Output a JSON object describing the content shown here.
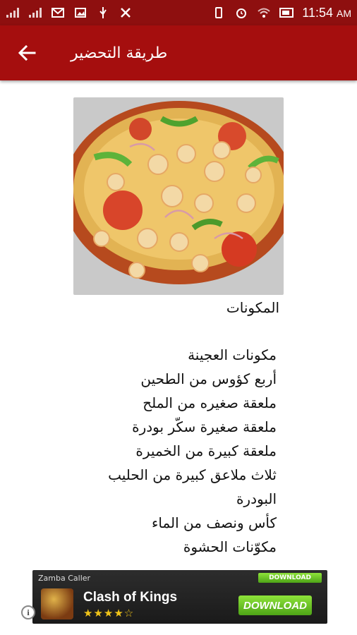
{
  "status_bar": {
    "time": "11:54",
    "time_suffix": "AM"
  },
  "app_bar": {
    "title": "طريقة التحضير"
  },
  "content": {
    "heading": "المكونات",
    "lines": [
      "مكونات العجينة",
      "أربع كؤوس من الطحين",
      "ملعقة صغيره من الملح",
      "ملعقة صغيرة سكّر بودرة",
      "ملعقة كبيرة من الخميرة",
      "ثلاث ملاعق كبيرة من الحليب البودرة",
      "كأس ونصف من الماء",
      "مكوّنات الحشوة"
    ]
  },
  "ad": {
    "top_label": "Zamba Caller",
    "title": "Clash of Kings",
    "rating_stars": "★★★★☆",
    "rating_value": 4,
    "download_label": "DOWNLOAD",
    "download_small_label": "DOWNLOAD"
  },
  "colors": {
    "status_bar": "#8e0f0f",
    "app_bar": "#a50e0e",
    "download_green": "#5cb31e"
  },
  "icons": {
    "back": "arrow-left-icon"
  }
}
